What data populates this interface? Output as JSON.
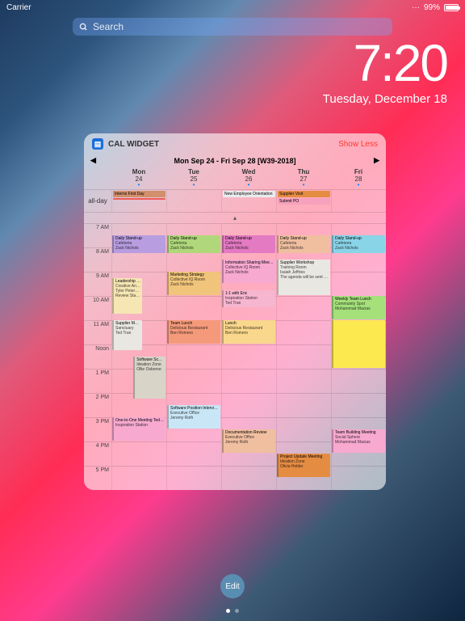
{
  "status": {
    "carrier": "Carrier",
    "battery_pct": "99%",
    "battery_fill": 99,
    "signal": "···"
  },
  "search": {
    "placeholder": "Search"
  },
  "clock": {
    "time": "7:20",
    "date": "Tuesday, December 18"
  },
  "widget": {
    "app_name": "CAL WIDGET",
    "show_less": "Show Less",
    "week_title": "Mon Sep 24 - Fri Sep 28 [W39-2018]",
    "nav_prev": "◀",
    "nav_next": "▶",
    "days": [
      {
        "dow": "Mon",
        "num": "24",
        "dot": true
      },
      {
        "dow": "Tue",
        "num": "25",
        "dot": true
      },
      {
        "dow": "Wed",
        "num": "26",
        "dot": true
      },
      {
        "dow": "Thu",
        "num": "27",
        "dot": true
      },
      {
        "dow": "Fri",
        "num": "28",
        "dot": true
      }
    ],
    "allday_label": "all-day",
    "allday": [
      [
        {
          "text": "Interns First Day",
          "bg": "#d18f6b"
        },
        {
          "text": "",
          "bg": "#f05a5a"
        }
      ],
      [],
      [
        {
          "text": "New Employee Orientation",
          "bg": "#e9ebee"
        }
      ],
      [
        {
          "text": "Supplier Visit",
          "bg": "#e58c43"
        },
        {
          "text": "Submit PO",
          "bg": "#f7a1be"
        }
      ],
      []
    ],
    "collapse": "▴",
    "hours": [
      "7 AM",
      "8 AM",
      "9 AM",
      "10 AM",
      "11 AM",
      "Noon",
      "1 PM",
      "2 PM",
      "3 PM",
      "4 PM",
      "5 PM"
    ],
    "events": [
      {
        "day": 0,
        "start": 7.5,
        "end": 8.25,
        "title": "Daily Stand-up",
        "loc": "Cafeteria",
        "who": "Zack Nichols",
        "bg": "#b89de0"
      },
      {
        "day": 1,
        "start": 7.5,
        "end": 8.25,
        "title": "Daily Stand-up",
        "loc": "Cafeteria",
        "who": "Zack Nichols",
        "bg": "#b0d87b"
      },
      {
        "day": 2,
        "start": 7.5,
        "end": 8.25,
        "title": "Daily Stand-up",
        "loc": "Cafeteria",
        "who": "Zack Nichols",
        "bg": "#e37ac2"
      },
      {
        "day": 3,
        "start": 7.5,
        "end": 8.25,
        "title": "Daily Stand-up",
        "loc": "Cafeteria",
        "who": "Zack Nichols",
        "bg": "#f0bfa0"
      },
      {
        "day": 4,
        "start": 7.5,
        "end": 8.25,
        "title": "Daily Stand-up",
        "loc": "Cafeteria",
        "who": "Zack Nichols",
        "bg": "#8ad4e8"
      },
      {
        "day": 2,
        "start": 8.5,
        "end": 9.5,
        "title": "Information Sharing Meetings",
        "loc": "Collective IQ Room",
        "who": "Zack Nichols",
        "bg": "#f7a9d0"
      },
      {
        "day": 3,
        "start": 8.5,
        "end": 10,
        "title": "Supplier Workshop",
        "loc": "Training Room",
        "who": "Isaiah Jeffries",
        "note": "The agenda will be sent later as an attachment",
        "bg": "#e9e7e2"
      },
      {
        "day": 1,
        "start": 9,
        "end": 10,
        "title": "Marketing Strategy",
        "loc": "Collective IQ Room",
        "who": "Zack Nichols",
        "bg": "#f0c47a"
      },
      {
        "day": 0,
        "start": 9.25,
        "end": 10.75,
        "title": "Leadership meeting",
        "loc": "Creative Annex",
        "who": "Tyler Peterson",
        "note": "Review Static Machine API Interface",
        "bg": "#f5e6b3",
        "half": 0
      },
      {
        "day": 2,
        "start": 9.75,
        "end": 10.5,
        "title": "1:1 with Eric",
        "loc": "Inspiration Station",
        "who": "Ted Tran",
        "bg": "#f7b6cf"
      },
      {
        "day": 4,
        "start": 10,
        "end": 11,
        "title": "Weekly Team Lunch",
        "loc": "Community Spot",
        "who": "Mohammad Macias",
        "bg": "#a5e07b"
      },
      {
        "day": 0,
        "start": 11,
        "end": 12.25,
        "title": "Supplier Meeting",
        "loc": "Sanctuary",
        "who": "Ted Tran",
        "bg": "#e9e7e2",
        "half": 0
      },
      {
        "day": 1,
        "start": 11,
        "end": 12,
        "title": "Team Lunch",
        "loc": "Delicious Restaurant",
        "who": "Ben Romero",
        "bg": "#f49a7a"
      },
      {
        "day": 2,
        "start": 11,
        "end": 12,
        "title": "Lunch",
        "loc": "Delicious Restaurant",
        "who": "Ben Romero",
        "bg": "#f9d78c"
      },
      {
        "day": 4,
        "start": 11,
        "end": 13,
        "title": "",
        "loc": "",
        "who": "",
        "bg": "#fce94f"
      },
      {
        "day": 0,
        "start": 12.5,
        "end": 14.25,
        "title": "Software Scaffolding",
        "loc": "Ideation Zone",
        "who": "Ollie Osborne",
        "bg": "#d9d4c8",
        "half": 1
      },
      {
        "day": 1,
        "start": 14.5,
        "end": 15.5,
        "title": "Software Position Interview",
        "loc": "Executive Office",
        "who": "Jeremy Roth",
        "bg": "#c8e6f5"
      },
      {
        "day": 0,
        "start": 15,
        "end": 16,
        "title": "One-to-One Meeting Ted with Jess",
        "loc": "Inspiration Station",
        "who": "",
        "bg": "#f7a9d0"
      },
      {
        "day": 2,
        "start": 15.5,
        "end": 16.5,
        "title": "Documentation Review",
        "loc": "Executive Office",
        "who": "Jeremy Roth",
        "bg": "#f0bfa0"
      },
      {
        "day": 4,
        "start": 15.5,
        "end": 16.5,
        "title": "Team Building Meeting",
        "loc": "Social Sphere",
        "who": "Mohammad Macias",
        "bg": "#f7a9d0"
      },
      {
        "day": 3,
        "start": 16.5,
        "end": 17.5,
        "title": "Project Update Meeting",
        "loc": "Ideation Zone",
        "who": "Olivia Holder",
        "bg": "#e58c43"
      }
    ]
  },
  "edit_label": "Edit"
}
